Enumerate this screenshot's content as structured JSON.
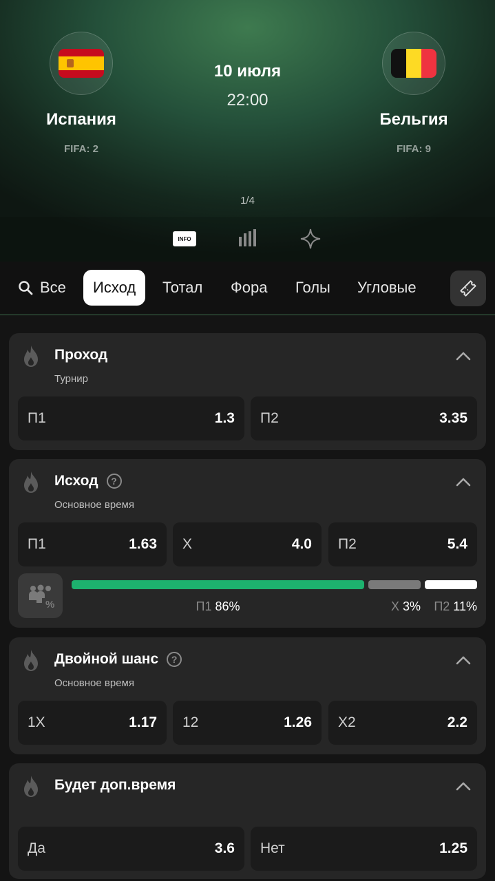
{
  "match": {
    "home": {
      "name": "Испания",
      "fifa": "FIFA: 2"
    },
    "away": {
      "name": "Бельгия",
      "fifa": "FIFA: 9"
    },
    "date": "10 июля",
    "time": "22:00",
    "pager": "1/4",
    "info_badge": "INFO"
  },
  "tabs": [
    {
      "label": "Все",
      "icon": "search-icon"
    },
    {
      "label": "Исход",
      "active": true
    },
    {
      "label": "Тотал"
    },
    {
      "label": "Фора"
    },
    {
      "label": "Голы"
    },
    {
      "label": "Угловые"
    }
  ],
  "markets": [
    {
      "title": "Проход",
      "subtitle": "Турнир",
      "odds": [
        {
          "label": "П1",
          "value": "1.3"
        },
        {
          "label": "П2",
          "value": "3.35"
        }
      ]
    },
    {
      "title": "Исход",
      "subtitle": "Основное время",
      "help": "?",
      "odds": [
        {
          "label": "П1",
          "value": "1.63"
        },
        {
          "label": "Х",
          "value": "4.0"
        },
        {
          "label": "П2",
          "value": "5.4"
        }
      ],
      "distribution": [
        {
          "label": "П1",
          "pct": "86%",
          "value": 86,
          "color": "#1db16e"
        },
        {
          "label": "Х",
          "pct": "3%",
          "value": 3,
          "color": "#7a7a7a"
        },
        {
          "label": "П2",
          "pct": "11%",
          "value": 11,
          "color": "#ffffff"
        }
      ]
    },
    {
      "title": "Двойной шанс",
      "subtitle": "Основное время",
      "help": "?",
      "odds": [
        {
          "label": "1Х",
          "value": "1.17"
        },
        {
          "label": "12",
          "value": "1.26"
        },
        {
          "label": "Х2",
          "value": "2.2"
        }
      ]
    },
    {
      "title": "Будет доп.время",
      "odds": [
        {
          "label": "Да",
          "value": "3.6"
        },
        {
          "label": "Нет",
          "value": "1.25"
        }
      ]
    }
  ],
  "colors": {
    "accent": "#1db16e",
    "background": "#141414",
    "card": "#262626"
  }
}
